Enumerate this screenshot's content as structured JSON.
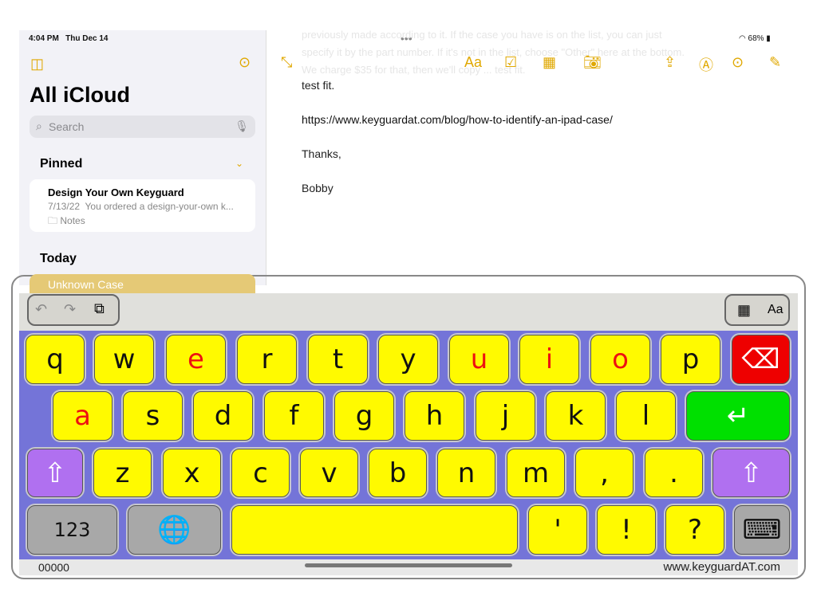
{
  "status": {
    "time": "4:04 PM",
    "date": "Thu Dec 14",
    "battery": "68%"
  },
  "sidebar": {
    "title": "All iCloud",
    "search_placeholder": "Search",
    "pinned_label": "Pinned",
    "today_label": "Today",
    "pinned_note": {
      "title": "Design Your Own Keyguard",
      "date": "7/13/22",
      "preview": "You ordered a design-your-own k...",
      "folder": "Notes"
    },
    "today_note": {
      "title": "Unknown Case"
    }
  },
  "note": {
    "faint_lines": [
      "previously made according to it. If the case you have is on the list, you can just",
      "specify it by the part number. If it's not in the list, choose \"Other\" here at the bottom.",
      "We charge $35 for that, then we'll copy ... test fit."
    ],
    "lines": [
      "test fit.",
      "https://www.keyguardat.com/blog/how-to-identify-an-ipad-case/",
      "Thanks,",
      "Bobby"
    ]
  },
  "toolbar": {
    "format_label": "Aa",
    "kbd_format_label": "Aa"
  },
  "keyboard": {
    "colors": {
      "key": "#fffa00",
      "vowel_text": "#ee1111",
      "backspace": "#ee0000",
      "enter": "#00e000",
      "shift": "#b070f0",
      "function": "#a8a8a8",
      "panel": "#7474d8"
    },
    "rows": [
      [
        "q",
        "w",
        "e",
        "r",
        "t",
        "y",
        "u",
        "i",
        "o",
        "p",
        "⌫"
      ],
      [
        "a",
        "s",
        "d",
        "f",
        "g",
        "h",
        "j",
        "k",
        "l",
        "↵"
      ],
      [
        "⇧",
        "z",
        "x",
        "c",
        "v",
        "b",
        "n",
        "m",
        ",",
        ".",
        "⇧"
      ],
      [
        "123",
        "🌐",
        " ",
        "'",
        "!",
        "?",
        "⌨"
      ]
    ],
    "counter": "00000",
    "website": "www.keyguardAT.com"
  }
}
